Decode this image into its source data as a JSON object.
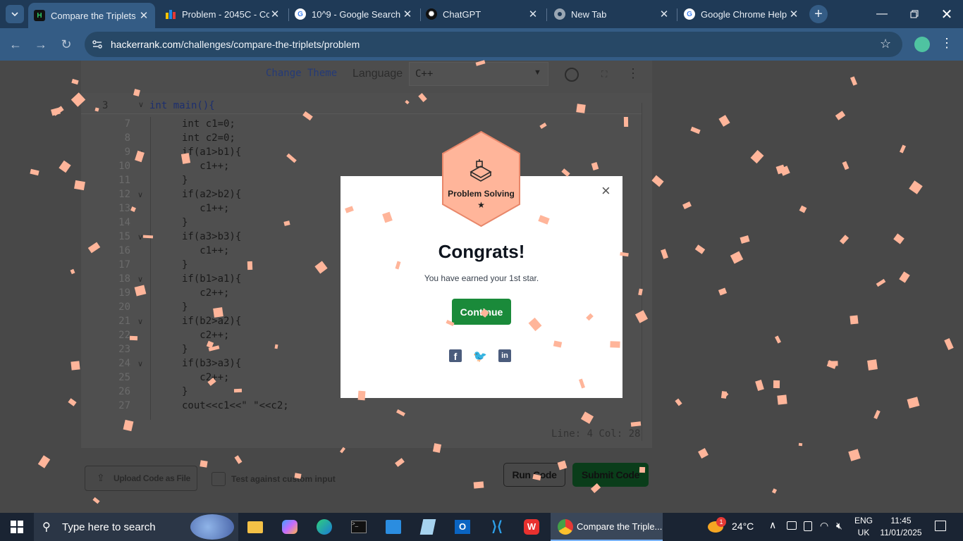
{
  "browser": {
    "tabs": [
      {
        "title": "Compare the Triplets",
        "favicon": "hackerrank-icon",
        "active": true
      },
      {
        "title": "Problem - 2045C - Cc",
        "favicon": "codeforces-icon",
        "active": false
      },
      {
        "title": "10^9 - Google Search",
        "favicon": "google-icon",
        "active": false
      },
      {
        "title": "ChatGPT",
        "favicon": "chatgpt-icon",
        "active": false
      },
      {
        "title": "New Tab",
        "favicon": "chrome-icon",
        "active": false
      },
      {
        "title": "Google Chrome Help",
        "favicon": "google-icon",
        "active": false
      }
    ],
    "url": "hackerrank.com/challenges/compare-the-triplets/problem",
    "url_domain": "hackerrank.com",
    "url_path": "/challenges/compare-the-triplets/problem"
  },
  "editor": {
    "change_theme": "Change Theme",
    "language_label": "Language",
    "language_value": "C++",
    "pinned_line_no": "3",
    "pinned_line": "int main(){",
    "lines": [
      {
        "n": "7",
        "text": "int c1=0;"
      },
      {
        "n": "8",
        "text": "int c2=0;"
      },
      {
        "n": "9",
        "text": "if(a1>b1){",
        "fold": true
      },
      {
        "n": "10",
        "text": "   c1++;"
      },
      {
        "n": "11",
        "text": "}"
      },
      {
        "n": "12",
        "text": "if(a2>b2){",
        "fold": true
      },
      {
        "n": "13",
        "text": "   c1++;"
      },
      {
        "n": "14",
        "text": "}"
      },
      {
        "n": "15",
        "text": "if(a3>b3){",
        "fold": true
      },
      {
        "n": "16",
        "text": "   c1++;"
      },
      {
        "n": "17",
        "text": "}"
      },
      {
        "n": "18",
        "text": "if(b1>a1){",
        "fold": true
      },
      {
        "n": "19",
        "text": "   c2++;"
      },
      {
        "n": "20",
        "text": "}"
      },
      {
        "n": "21",
        "text": "if(b2>a2){",
        "fold": true
      },
      {
        "n": "22",
        "text": "   c2++;"
      },
      {
        "n": "23",
        "text": "}"
      },
      {
        "n": "24",
        "text": "if(b3>a3){",
        "fold": true
      },
      {
        "n": "25",
        "text": "   c2++;"
      },
      {
        "n": "26",
        "text": "}"
      },
      {
        "n": "27",
        "text": "cout<<c1<<\" \"<<c2;"
      }
    ],
    "cursor_status": "Line: 4 Col: 28",
    "upload_label": "Upload Code as File",
    "custom_input_label": "Test against custom input",
    "run_label": "Run Code",
    "submit_label": "Submit Code"
  },
  "modal": {
    "badge_title": "Problem Solving",
    "badge_star": "★",
    "heading": "Congrats!",
    "message": "You have earned your 1st star.",
    "continue_label": "Continue",
    "close_label": "×",
    "share_icons": [
      "facebook-icon",
      "twitter-icon",
      "linkedin-icon"
    ]
  },
  "taskbar": {
    "search_placeholder": "Type here to search",
    "active_app_label": "Compare the Triple...",
    "weather": "24°C",
    "weather_badge": "1",
    "language_top": "ENG",
    "language_bottom": "UK",
    "time": "11:45",
    "date": "11/01/2025"
  },
  "colors": {
    "tabstrip": "#1f3a57",
    "toolbar": "#345c85",
    "overlay_bg": "#484848",
    "continue_green": "#1a8a3a",
    "submit_green": "#0a3d1a",
    "badge_peach": "#ffb59a",
    "confetti": "#ffb59a",
    "taskbar": "#1a2433"
  }
}
